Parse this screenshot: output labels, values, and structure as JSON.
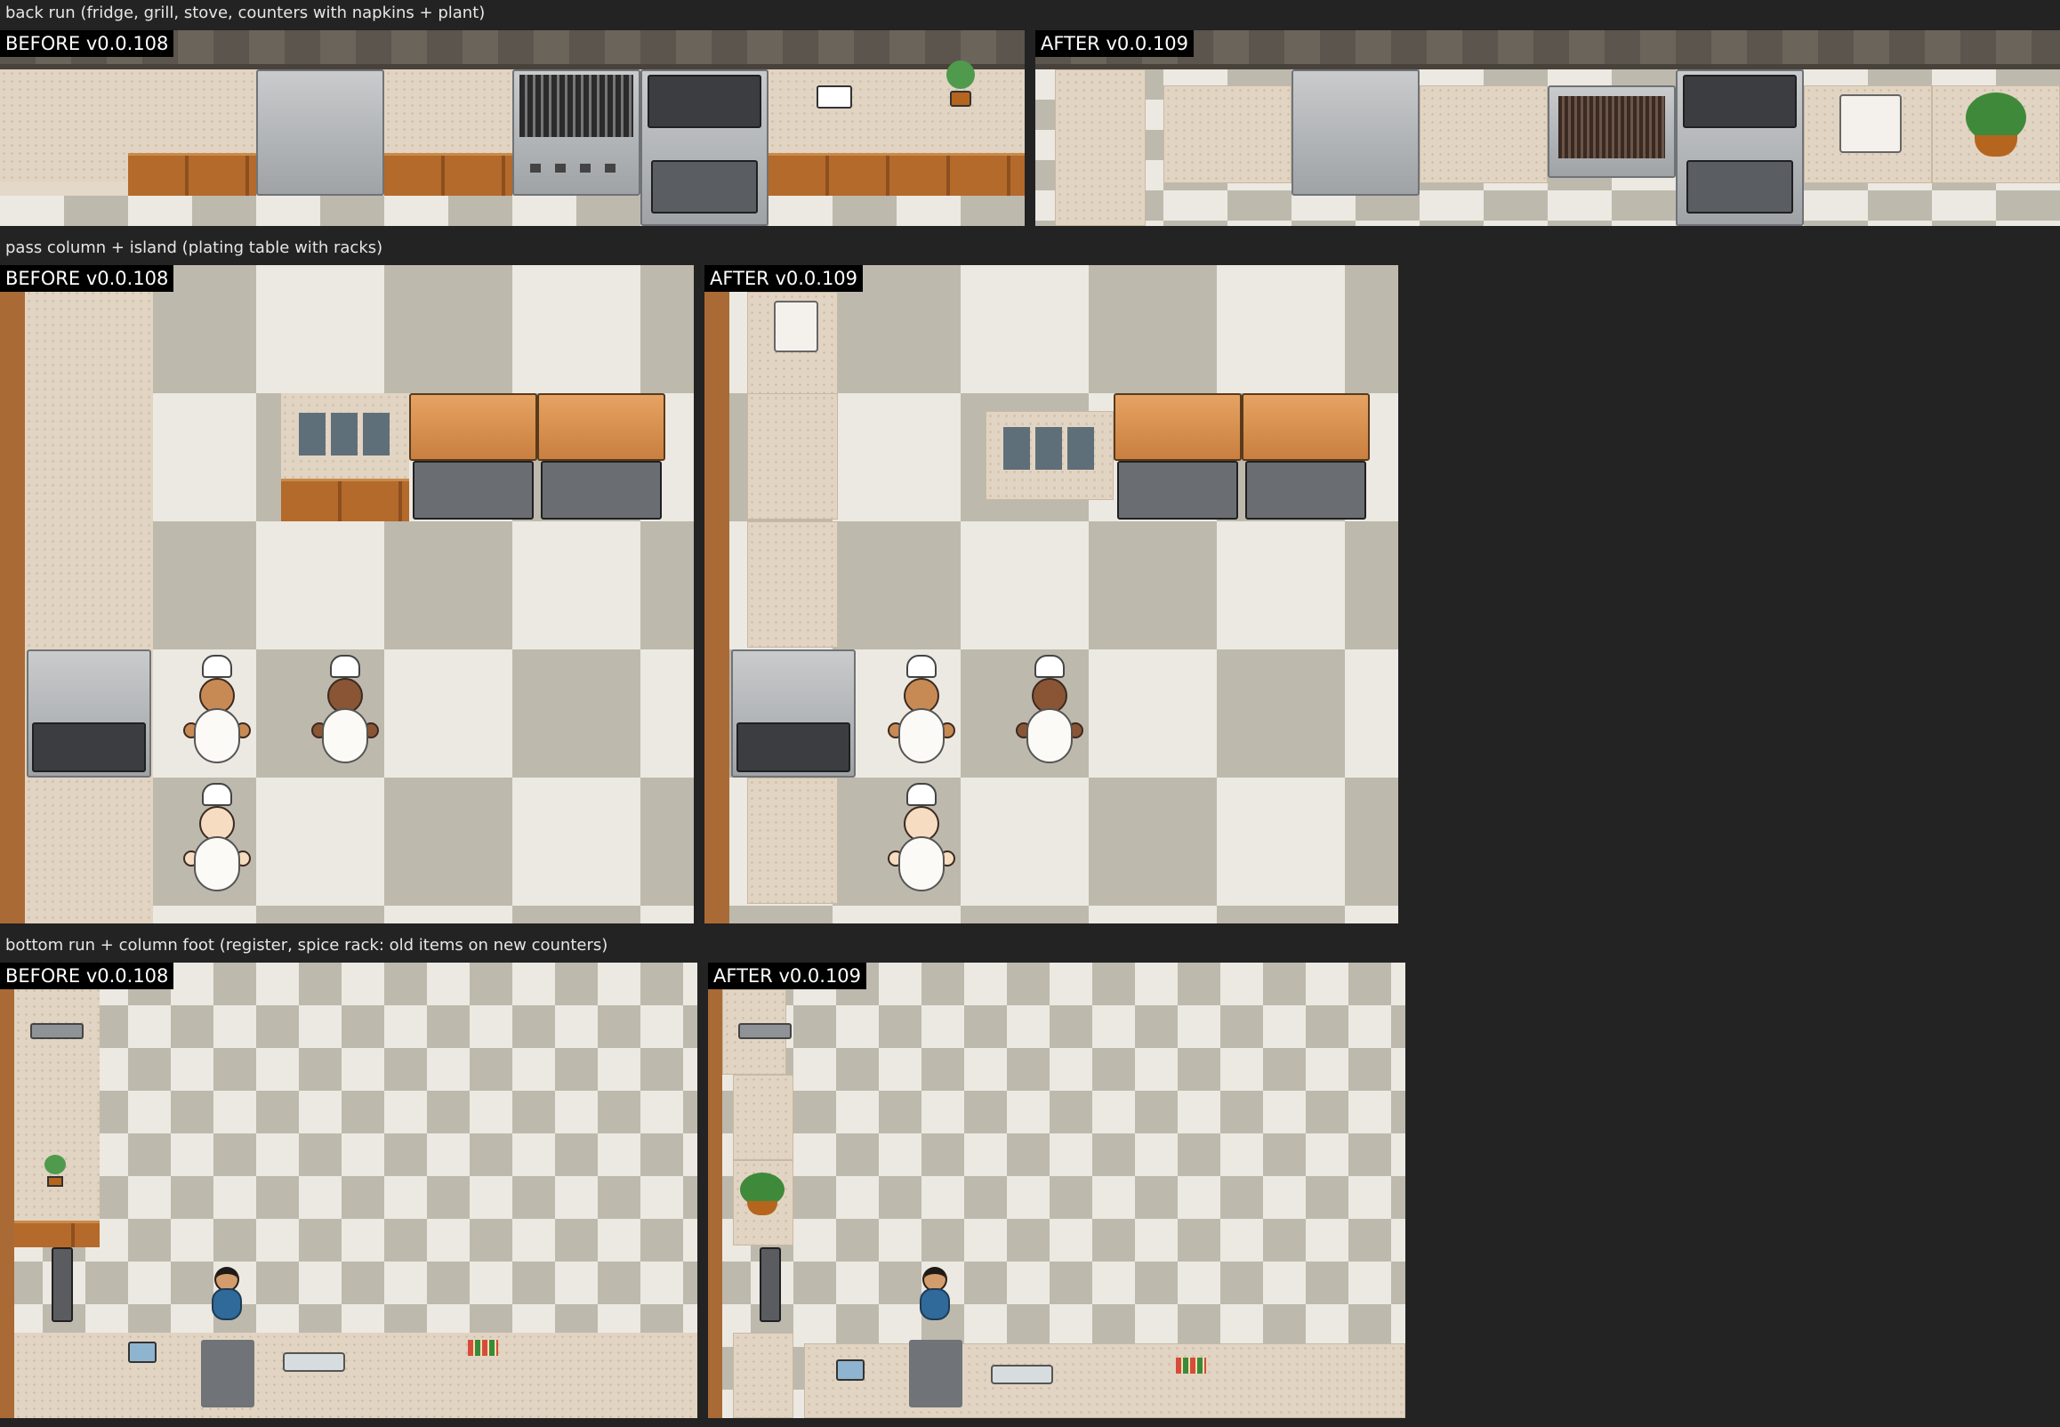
{
  "sections": [
    {
      "title": "back run (fridge, grill, stove, counters with napkins + plant)",
      "before_label": "BEFORE v0.0.108",
      "after_label": "AFTER v0.0.109"
    },
    {
      "title": "pass column + island (plating table with racks)",
      "before_label": "BEFORE v0.0.108",
      "after_label": "AFTER v0.0.109"
    },
    {
      "title": "bottom run + column foot (register, spice rack: old items on new counters)",
      "before_label": "BEFORE v0.0.108",
      "after_label": "AFTER v0.0.109"
    }
  ],
  "colors": {
    "page_bg": "#232323",
    "label_bg": "#000000",
    "floor_light": "#ece9e2",
    "floor_dark": "#bdb9ad",
    "counter_top": "#e2d4c2",
    "wood_cabinet": "#b46a2b"
  },
  "icons": [
    "fridge-icon",
    "grill-icon",
    "stove-icon",
    "napkin-holder-icon",
    "potted-plant-icon",
    "plating-rack-icon",
    "butcher-block-table-icon",
    "heat-lamp-pass-icon",
    "chef-icon",
    "waiter-icon",
    "sink-icon",
    "register-icon",
    "spice-rack-icon",
    "paper-towel-icon",
    "knife-block-icon"
  ]
}
